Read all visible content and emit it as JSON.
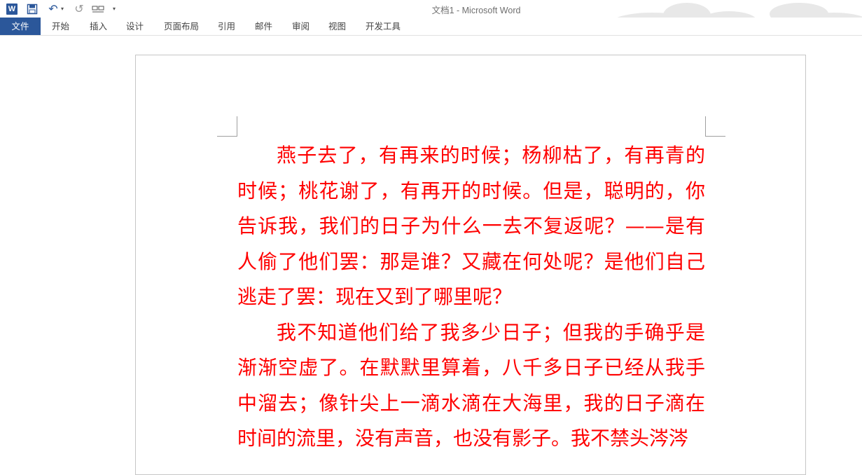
{
  "app": {
    "window_title": "文档1 - Microsoft Word",
    "word_icon_letter": "W"
  },
  "quick_access": {
    "undo_glyph": "↶",
    "redo_glyph": "↺",
    "dropdown_glyph": "▾"
  },
  "ribbon": {
    "tabs": [
      "文件",
      "开始",
      "插入",
      "设计",
      "页面布局",
      "引用",
      "邮件",
      "审阅",
      "视图",
      "开发工具"
    ]
  },
  "document": {
    "paragraphs": [
      "燕子去了，有再来的时候；杨柳枯了，有再青的时候；桃花谢了，有再开的时候。但是，聪明的，你告诉我，我们的日子为什么一去不复返呢？——是有人偷了他们罢：那是谁？又藏在何处呢？是他们自己逃走了罢：现在又到了哪里呢？",
      "我不知道他们给了我多少日子；但我的手确乎是渐渐空虚了。在默默里算着，八千多日子已经从我手中溜去；像针尖上一滴水滴在大海里，我的日子滴在时间的流里，没有声音，也没有影子。我不禁头涔涔"
    ]
  },
  "colors": {
    "accent": "#2b579a",
    "text": "#ff0000"
  }
}
